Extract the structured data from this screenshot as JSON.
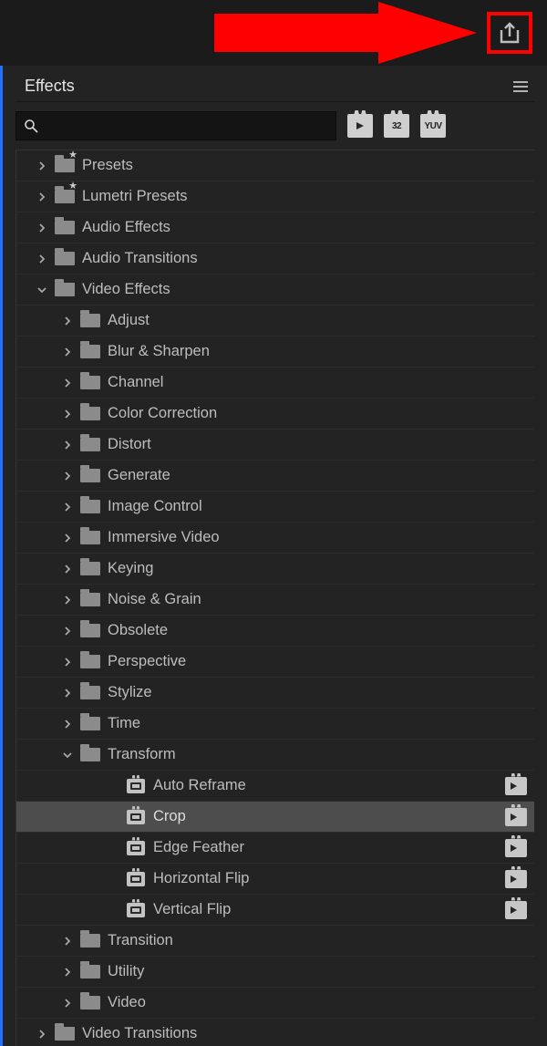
{
  "panel": {
    "title": "Effects"
  },
  "search": {
    "placeholder": ""
  },
  "toggles": [
    "⏵",
    "32",
    "YUV"
  ],
  "tree": [
    {
      "label": "Presets",
      "depth": 0,
      "chev": "right",
      "icon": "folder-star"
    },
    {
      "label": "Lumetri Presets",
      "depth": 0,
      "chev": "right",
      "icon": "folder-star"
    },
    {
      "label": "Audio Effects",
      "depth": 0,
      "chev": "right",
      "icon": "folder"
    },
    {
      "label": "Audio Transitions",
      "depth": 0,
      "chev": "right",
      "icon": "folder"
    },
    {
      "label": "Video Effects",
      "depth": 0,
      "chev": "down",
      "icon": "folder"
    },
    {
      "label": "Adjust",
      "depth": 1,
      "chev": "right",
      "icon": "folder"
    },
    {
      "label": "Blur & Sharpen",
      "depth": 1,
      "chev": "right",
      "icon": "folder"
    },
    {
      "label": "Channel",
      "depth": 1,
      "chev": "right",
      "icon": "folder"
    },
    {
      "label": "Color Correction",
      "depth": 1,
      "chev": "right",
      "icon": "folder"
    },
    {
      "label": "Distort",
      "depth": 1,
      "chev": "right",
      "icon": "folder"
    },
    {
      "label": "Generate",
      "depth": 1,
      "chev": "right",
      "icon": "folder"
    },
    {
      "label": "Image Control",
      "depth": 1,
      "chev": "right",
      "icon": "folder"
    },
    {
      "label": "Immersive Video",
      "depth": 1,
      "chev": "right",
      "icon": "folder"
    },
    {
      "label": "Keying",
      "depth": 1,
      "chev": "right",
      "icon": "folder"
    },
    {
      "label": "Noise & Grain",
      "depth": 1,
      "chev": "right",
      "icon": "folder"
    },
    {
      "label": "Obsolete",
      "depth": 1,
      "chev": "right",
      "icon": "folder"
    },
    {
      "label": "Perspective",
      "depth": 1,
      "chev": "right",
      "icon": "folder"
    },
    {
      "label": "Stylize",
      "depth": 1,
      "chev": "right",
      "icon": "folder"
    },
    {
      "label": "Time",
      "depth": 1,
      "chev": "right",
      "icon": "folder"
    },
    {
      "label": "Transform",
      "depth": 1,
      "chev": "down",
      "icon": "folder"
    },
    {
      "label": "Auto Reframe",
      "depth": 2,
      "chev": "none",
      "icon": "preset",
      "badge": true
    },
    {
      "label": "Crop",
      "depth": 2,
      "chev": "none",
      "icon": "preset",
      "badge": true,
      "selected": true
    },
    {
      "label": "Edge Feather",
      "depth": 2,
      "chev": "none",
      "icon": "preset",
      "badge": true
    },
    {
      "label": "Horizontal Flip",
      "depth": 2,
      "chev": "none",
      "icon": "preset",
      "badge": true
    },
    {
      "label": "Vertical Flip",
      "depth": 2,
      "chev": "none",
      "icon": "preset",
      "badge": true
    },
    {
      "label": "Transition",
      "depth": 1,
      "chev": "right",
      "icon": "folder"
    },
    {
      "label": "Utility",
      "depth": 1,
      "chev": "right",
      "icon": "folder"
    },
    {
      "label": "Video",
      "depth": 1,
      "chev": "right",
      "icon": "folder"
    },
    {
      "label": "Video Transitions",
      "depth": 0,
      "chev": "right",
      "icon": "folder"
    }
  ]
}
